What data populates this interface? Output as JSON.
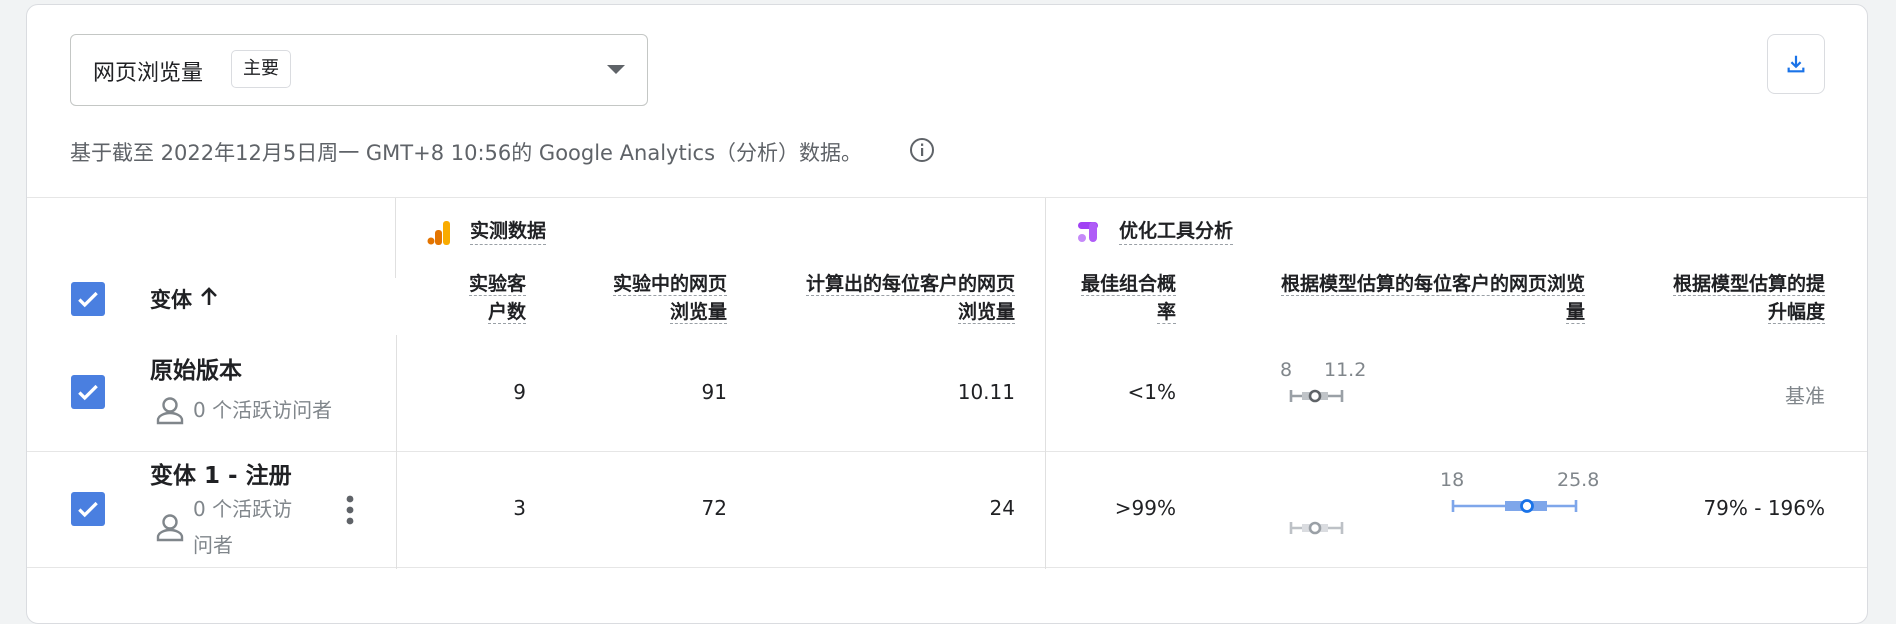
{
  "header": {
    "metric_label": "网页浏览量",
    "metric_badge": "主要",
    "info_text": "基于截至 2022年12月5日周一 GMT+8 10:56的 Google Analytics（分析）数据。"
  },
  "icons": {
    "download": "download-icon",
    "info": "info-icon",
    "dropdown": "chevron-down-icon",
    "sort": "arrow-up-icon",
    "person": "person-icon",
    "more": "more-vert-icon"
  },
  "colors": {
    "checkbox": "#4a7fe0",
    "accent_blue": "#1a73e8",
    "ci_gray": "#80868b",
    "ci_blue": "#7ea6ea"
  },
  "table": {
    "groups": {
      "observed": "实测数据",
      "optimizer": "优化工具分析"
    },
    "variant_header": "变体",
    "columns": {
      "users": [
        "实验客",
        "户数"
      ],
      "pageviews": [
        "实验中的网页",
        "浏览量"
      ],
      "per_user": [
        "计算出的每位客户的网页",
        "浏览量"
      ],
      "prob_best": [
        "最佳组合概",
        "率"
      ],
      "modeled": [
        "根据模型估算的每位客户的网页浏览",
        "量"
      ],
      "improvement": [
        "根据模型估算的提",
        "升幅度"
      ]
    },
    "rows": [
      {
        "name": "原始版本",
        "visitors": "0 个活跃访问者",
        "users": "9",
        "pageviews": "91",
        "per_user": "10.11",
        "prob_best": "<1%",
        "ci_low": "8",
        "ci_high": "11.2",
        "improvement": "基准"
      },
      {
        "name": "变体 1 - 注册",
        "visitors": [
          "0 个活跃访",
          "问者"
        ],
        "users": "3",
        "pageviews": "72",
        "per_user": "24",
        "prob_best": ">99%",
        "ci_low": "18",
        "ci_high": "25.8",
        "improvement": "79% - 196%"
      }
    ]
  }
}
